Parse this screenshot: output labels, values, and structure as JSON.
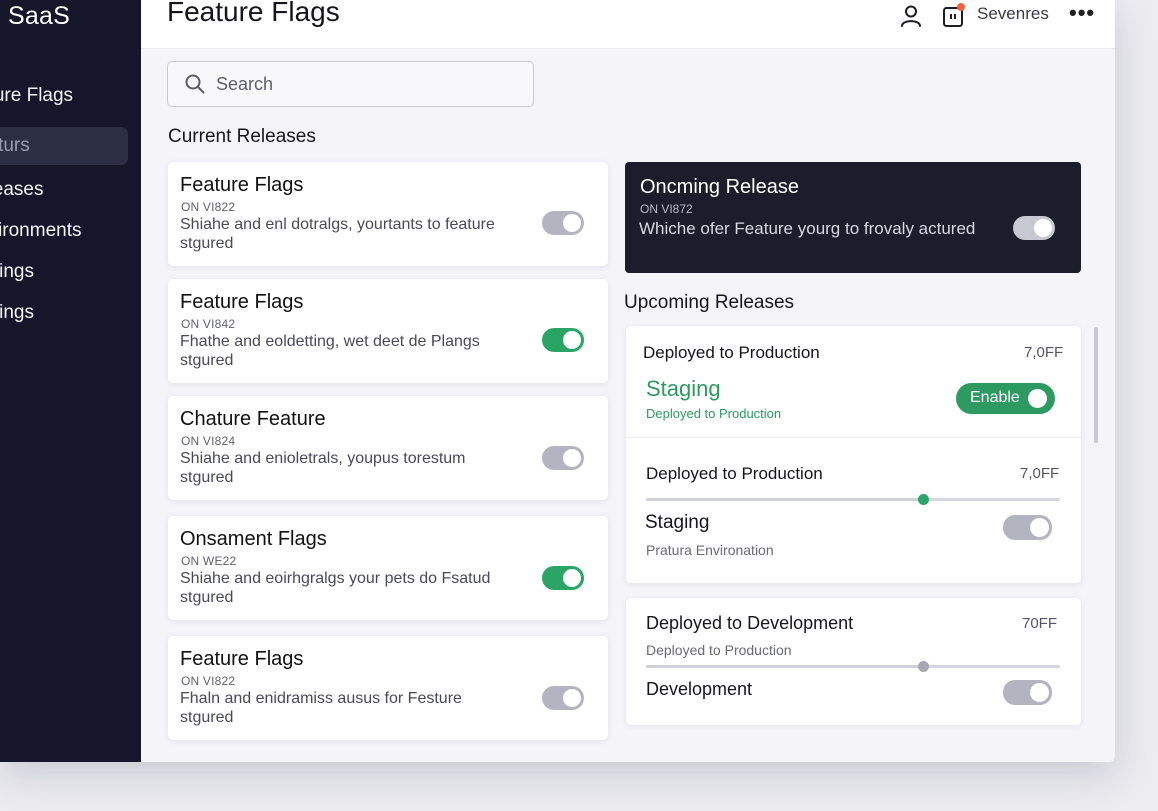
{
  "sidebar": {
    "brand": "SaaS",
    "items": [
      {
        "label": "ature Flags"
      },
      {
        "label": "esturs"
      },
      {
        "label": "eleases"
      },
      {
        "label": "nvironments"
      },
      {
        "label": "ettings"
      },
      {
        "label": "ettings"
      }
    ]
  },
  "header": {
    "title": "Feature Flags",
    "user_name": "Sevenres",
    "more_label": "•••"
  },
  "search": {
    "placeholder": "Search"
  },
  "current": {
    "title": "Current Releases",
    "cards": [
      {
        "title": "Feature Flags",
        "version": "ON VI822",
        "desc": "Shiahe and enl dotralgs, yourtants to feature stgured",
        "enabled": false
      },
      {
        "title": "Feature Flags",
        "version": "ON VI842",
        "desc": "Fhathe and eoldetting, wet deet de Plangs stgured",
        "enabled": true
      },
      {
        "title": "Chature Feature",
        "version": "ON VI824",
        "desc": "Shiahe and enioletrals, youpus torestum stgured",
        "enabled": false
      },
      {
        "title": "Onsament Flags",
        "version": "ON WE22",
        "desc": "Shiahe and eoirhgralgs your pets do Fsatud stgured",
        "enabled": true
      },
      {
        "title": "Feature Flags",
        "version": "ON VI822",
        "desc": "Fhaln and enidramiss ausus for Festure stgured",
        "enabled": false
      }
    ]
  },
  "oncoming": {
    "title": "Oncming Release",
    "version": "ON VI872",
    "desc": "Whiche ofer Feature yourg to frovaly actured",
    "enabled": true
  },
  "upcoming": {
    "title": "Upcoming Releases",
    "panel1": {
      "row1_label": "Deployed to Production",
      "row1_value": "7,0FF",
      "staging_label": "Staging",
      "staging_sub": "Deployed to Production",
      "enable_label": "Enable",
      "row2_label": "Deployed to Production",
      "row2_value": "7,0FF",
      "row2_slider": 0.67,
      "staging2_label": "Staging",
      "staging2_sub": "Pratura Environation",
      "staging2_enabled": false
    },
    "panel2": {
      "row1_label": "Deployed to Development",
      "row1_value": "70FF",
      "sub": "Deployed to Production",
      "slider": 0.67,
      "dev_label": "Development",
      "dev_enabled": false
    }
  },
  "colors": {
    "sidebar_bg": "#15162a",
    "accent_green": "#2aa566",
    "dark_card": "#1c1d2a",
    "notify_dot": "#f2613f"
  }
}
